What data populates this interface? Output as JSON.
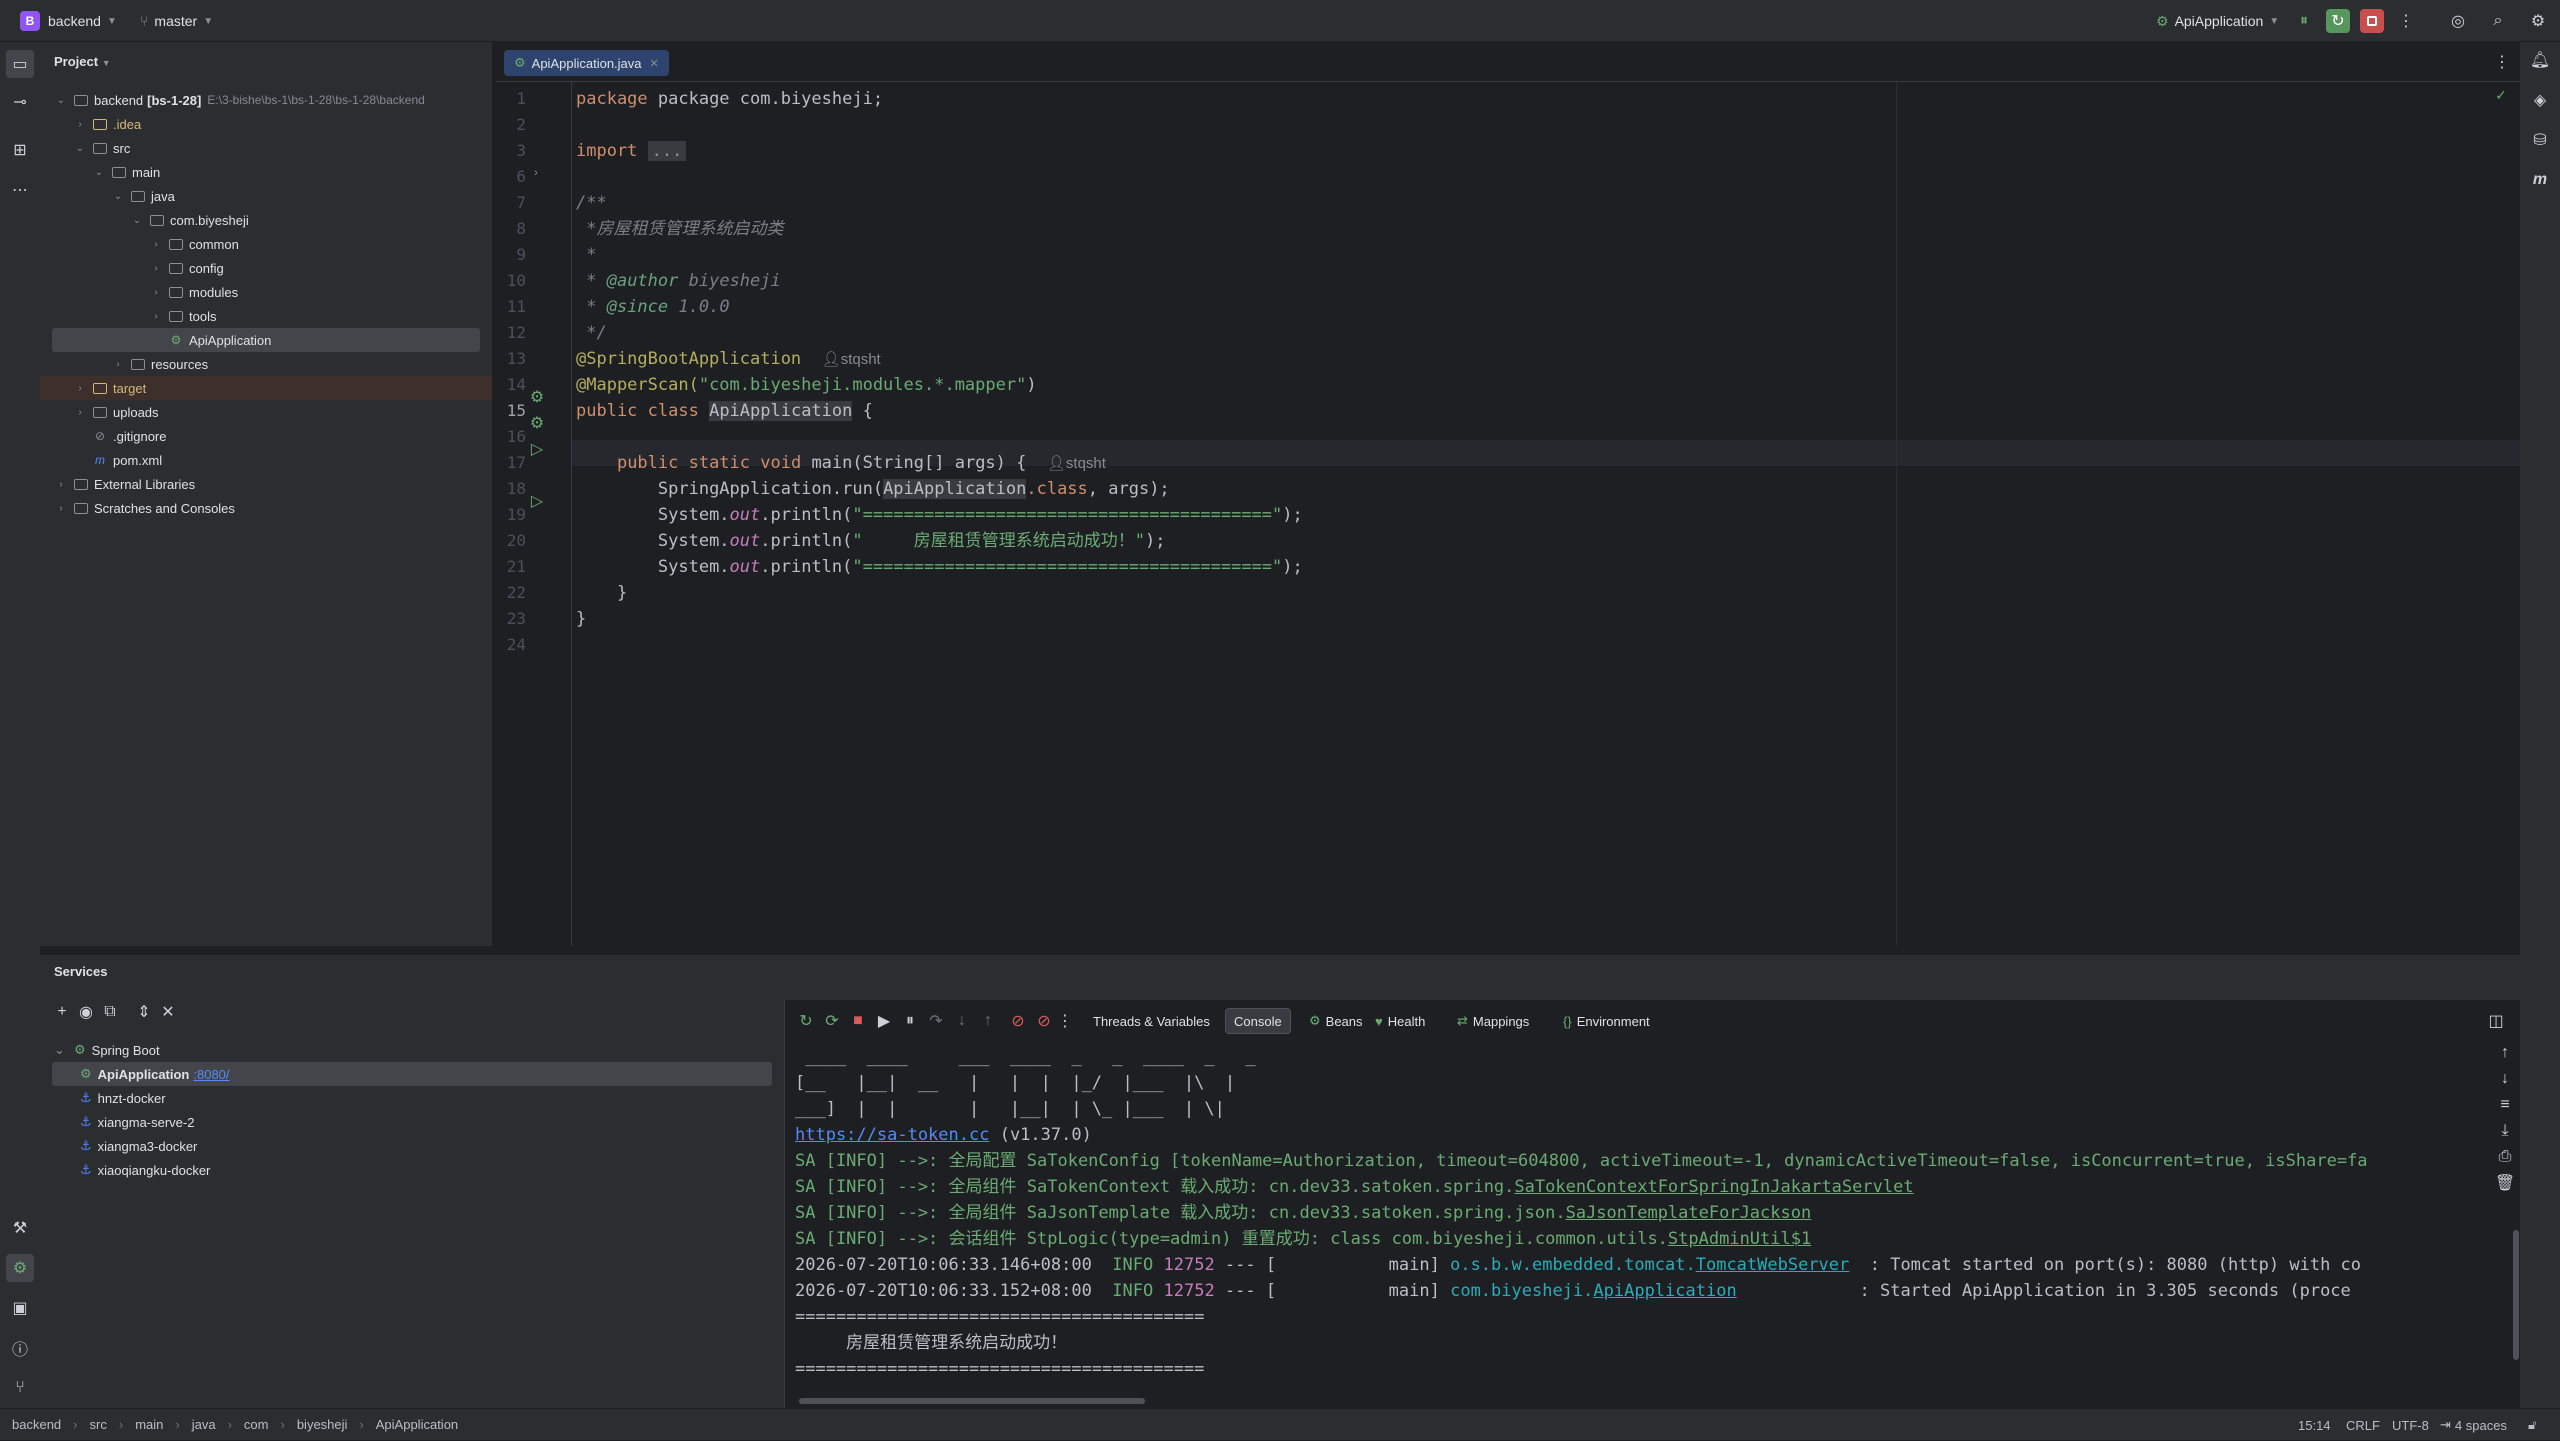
{
  "titlebar": {
    "project_badge": "B",
    "project_name": "backend",
    "branch": "master",
    "run_config": "ApiApplication"
  },
  "project_panel": {
    "title": "Project",
    "tree": [
      {
        "label": "backend",
        "bold_suffix": "[bs-1-28]",
        "path": "E:\\3-bishe\\bs-1\\bs-1-28\\bs-1-28\\backend",
        "depth": 0,
        "arrow": "down"
      },
      {
        "label": ".idea",
        "depth": 1,
        "arrow": "right",
        "color": "#d5b778"
      },
      {
        "label": "src",
        "depth": 1,
        "arrow": "down"
      },
      {
        "label": "main",
        "depth": 2,
        "arrow": "down"
      },
      {
        "label": "java",
        "depth": 3,
        "arrow": "down"
      },
      {
        "label": "com.biyesheji",
        "depth": 4,
        "arrow": "down"
      },
      {
        "label": "common",
        "depth": 5,
        "arrow": "right"
      },
      {
        "label": "config",
        "depth": 5,
        "arrow": "right"
      },
      {
        "label": "modules",
        "depth": 5,
        "arrow": "right"
      },
      {
        "label": "tools",
        "depth": 5,
        "arrow": "right"
      },
      {
        "label": "ApiApplication",
        "depth": 5,
        "arrow": "none",
        "selected": true
      },
      {
        "label": "resources",
        "depth": 3,
        "arrow": "right"
      },
      {
        "label": "target",
        "depth": 1,
        "arrow": "right",
        "color": "#d5b778",
        "excluded": true
      },
      {
        "label": "uploads",
        "depth": 1,
        "arrow": "right"
      },
      {
        "label": ".gitignore",
        "depth": 1,
        "arrow": "none"
      },
      {
        "label": "pom.xml",
        "depth": 1,
        "arrow": "none"
      },
      {
        "label": "External Libraries",
        "depth": 0,
        "arrow": "right"
      },
      {
        "label": "Scratches and Consoles",
        "depth": 0,
        "arrow": "right"
      }
    ]
  },
  "editor": {
    "tab": "ApiApplication.java",
    "line_numbers": [
      "1",
      "2",
      "3",
      "6",
      "7",
      "8",
      "9",
      "10",
      "11",
      "12",
      "13",
      "14",
      "15",
      "16",
      "17",
      "18",
      "19",
      "20",
      "21",
      "22",
      "23",
      "24"
    ],
    "current_line": "15",
    "code": {
      "l1": "package com.biyesheji;",
      "l3_import": "import",
      "l3_fold": "...",
      "l7": "/**",
      "l8": " *房屋租赁管理系统启动类",
      "l9": " *",
      "l10_tag": "@author",
      "l10_val": "biyesheji",
      "l11_tag": "@since",
      "l11_val": "1.0.0",
      "l12": " */",
      "l13": "@SpringBootApplication",
      "l13_author": "stqsht",
      "l14_ann": "@MapperScan(",
      "l14_str": "\"com.biyesheji.modules.*.mapper\"",
      "l14_end": ")",
      "l15_kw": "public class",
      "l15_name": "ApiApplication",
      "l15_end": "{",
      "l17_kw": "public static void",
      "l17_rest": "main(String[] args) {",
      "l17_author": "stqsht",
      "l18_a": "SpringApplication.run(",
      "l18_b": "ApiApplication",
      "l18_c": ".class",
      "l18_d": ", args);",
      "l19_a": "System.",
      "l19_out": "out",
      "l19_b": ".println(",
      "l19_str": "\"========================================\"",
      "l19_end": ");",
      "l20_str": "\"     房屋租赁管理系统启动成功！\"",
      "l21_str": "\"========================================\"",
      "l22": "}",
      "l23": "}"
    }
  },
  "services": {
    "title": "Services",
    "tree": [
      {
        "label": "Spring Boot",
        "depth": 0
      },
      {
        "label": "ApiApplication",
        "port": ":8080/",
        "depth": 1,
        "selected": true
      },
      {
        "label": "hnzt-docker",
        "depth": 1
      },
      {
        "label": "xiangma-serve-2",
        "depth": 1
      },
      {
        "label": "xiangma3-docker",
        "depth": 1
      },
      {
        "label": "xiaoqiangku-docker",
        "depth": 1
      }
    ],
    "console_tabs": [
      "Threads & Variables",
      "Console",
      "Beans",
      "Health",
      "Mappings",
      "Environment"
    ],
    "active_tab": "Console",
    "banner": [
      " ____  ____     ___  ____  _   _  ____  _   _",
      "[__   |__|  __   |   |  |  |_/  |___  |\\  |",
      "___]  |  |       |   |__|  | \\_ |___  | \\|"
    ],
    "sa_link": "https://sa-token.cc",
    "sa_version": " (v1.37.0)",
    "logs": [
      {
        "prefix": "SA [INFO] -->: ",
        "text": "全局配置 SaTokenConfig [tokenName=Authorization, timeout=604800, activeTimeout=-1, dynamicActiveTimeout=false, isConcurrent=true, isShare=fa"
      },
      {
        "prefix": "SA [INFO] -->: ",
        "text": "全局组件 SaTokenContext 载入成功: cn.dev33.satoken.spring.",
        "link": "SaTokenContextForSpringInJakartaServlet"
      },
      {
        "prefix": "SA [INFO] -->: ",
        "text": "全局组件 SaJsonTemplate 载入成功: cn.dev33.satoken.spring.json.",
        "link": "SaJsonTemplateForJackson"
      },
      {
        "prefix": "SA [INFO] -->: ",
        "text": "会话组件 StpLogic(type=admin) 重置成功: class com.biyesheji.common.utils.",
        "link": "StpAdminUtil$1"
      }
    ],
    "spring_logs": [
      {
        "ts": "2026-07-20T10:06:33.146+08:00",
        "level": "INFO",
        "pid": "12752",
        "mid": " --- [           main] ",
        "logger_a": "o.s.b.w.embedded.tomcat.",
        "logger_b": "TomcatWebServer",
        "msg": "  : Tomcat started on port(s): 8080 (http) with co"
      },
      {
        "ts": "2026-07-20T10:06:33.152+08:00",
        "level": "INFO",
        "pid": "12752",
        "mid": " --- [           main] ",
        "logger_a": "com.biyesheji.",
        "logger_b": "ApiApplication",
        "msg": "            : Started ApiApplication in 3.305 seconds (proce"
      }
    ],
    "sep1": "========================================",
    "success": "     房屋租赁管理系统启动成功！",
    "sep2": "========================================"
  },
  "statusbar": {
    "breadcrumbs": [
      "backend",
      "src",
      "main",
      "java",
      "com",
      "biyesheji",
      "ApiApplication"
    ],
    "position": "15:14",
    "line_sep": "CRLF",
    "encoding": "UTF-8",
    "indent": "4 spaces"
  }
}
